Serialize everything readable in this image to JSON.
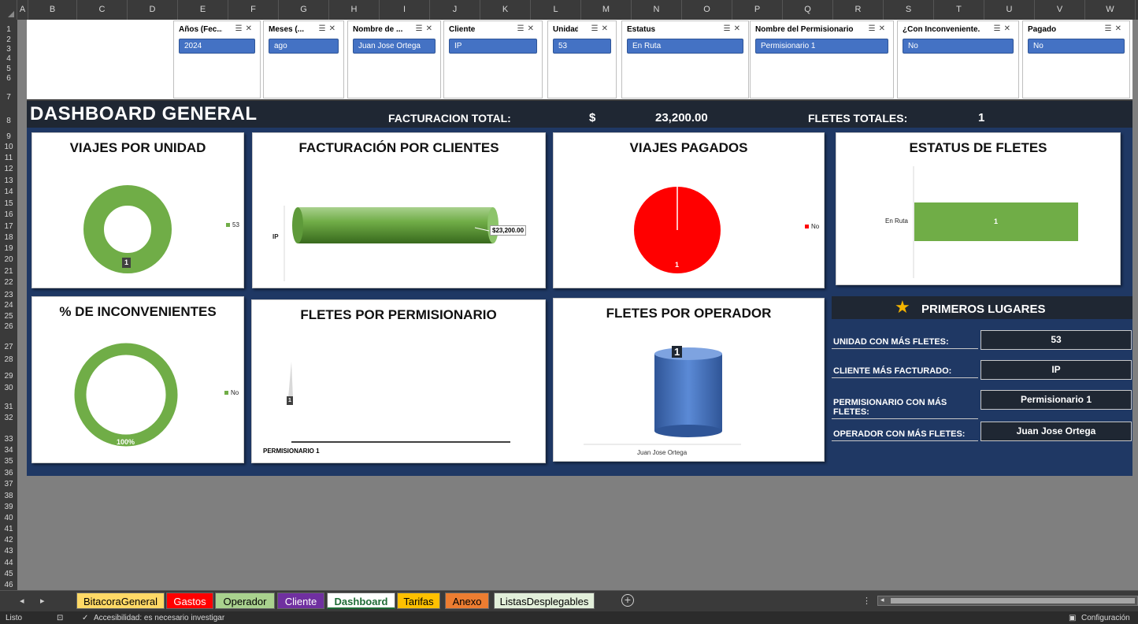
{
  "columns": [
    "A",
    "B",
    "C",
    "D",
    "E",
    "F",
    "G",
    "H",
    "I",
    "J",
    "K",
    "L",
    "M",
    "N",
    "O",
    "P",
    "Q",
    "R",
    "S",
    "T",
    "U",
    "V",
    "W"
  ],
  "rows": [
    "1",
    "2",
    "3",
    "4",
    "5",
    "6",
    "7",
    "8",
    "9",
    "10",
    "11",
    "12",
    "13",
    "14",
    "15",
    "16",
    "17",
    "18",
    "19",
    "20",
    "21",
    "22",
    "23",
    "24",
    "25",
    "26",
    "27",
    "28",
    "29",
    "30",
    "31",
    "32",
    "33",
    "34",
    "35",
    "36",
    "37",
    "38",
    "39",
    "40",
    "41",
    "42",
    "43",
    "44",
    "45",
    "46"
  ],
  "slicers": [
    {
      "title": "Años (Fec...",
      "value": "2024"
    },
    {
      "title": "Meses (...",
      "value": "ago"
    },
    {
      "title": "Nombre de ...",
      "value": "Juan Jose Ortega"
    },
    {
      "title": "Cliente",
      "value": "IP"
    },
    {
      "title": "Unidad",
      "value": "53"
    },
    {
      "title": "Estatus",
      "value": "En Ruta"
    },
    {
      "title": "Nombre del Permisionario",
      "value": "Permisionario 1"
    },
    {
      "title": "¿Con Inconveniente...",
      "value": "No"
    },
    {
      "title": "Pagado",
      "value": "No"
    }
  ],
  "header": {
    "title": "DASHBOARD GENERAL",
    "facturacion_label": "FACTURACION TOTAL:",
    "currency": "$",
    "facturacion_value": "23,200.00",
    "fletes_label": "FLETES TOTALES:",
    "fletes_value": "1"
  },
  "cards": {
    "viajes_unidad": {
      "title": "VIAJES POR UNIDAD",
      "legend": "53",
      "label": "1"
    },
    "facturacion_clientes": {
      "title": "FACTURACIÓN POR CLIENTES",
      "category": "IP",
      "label": "$23,200.00"
    },
    "viajes_pagados": {
      "title": "VIAJES PAGADOS",
      "legend": "No",
      "label": "1"
    },
    "estatus_fletes": {
      "title": "ESTATUS DE FLETES",
      "category": "En Ruta",
      "label": "1"
    },
    "inconvenientes": {
      "title": "% DE INCONVENIENTES",
      "legend": "No",
      "label": "100%"
    },
    "fletes_permisionario": {
      "title": "FLETES POR PERMISIONARIO",
      "category": "PERMISIONARIO 1",
      "label": "1"
    },
    "fletes_operador": {
      "title": "FLETES POR OPERADOR",
      "category": "Juan Jose Ortega",
      "label": "1"
    }
  },
  "chart_data": [
    {
      "type": "pie",
      "title": "VIAJES POR UNIDAD",
      "categories": [
        "53"
      ],
      "values": [
        1
      ]
    },
    {
      "type": "bar",
      "title": "FACTURACIÓN POR CLIENTES",
      "categories": [
        "IP"
      ],
      "values": [
        23200
      ]
    },
    {
      "type": "pie",
      "title": "VIAJES PAGADOS",
      "categories": [
        "No"
      ],
      "values": [
        1
      ]
    },
    {
      "type": "bar",
      "title": "ESTATUS DE FLETES",
      "categories": [
        "En Ruta"
      ],
      "values": [
        1
      ]
    },
    {
      "type": "pie",
      "title": "% DE INCONVENIENTES",
      "categories": [
        "No"
      ],
      "values": [
        1
      ]
    },
    {
      "type": "bar",
      "title": "FLETES POR PERMISIONARIO",
      "categories": [
        "PERMISIONARIO 1"
      ],
      "values": [
        1
      ]
    },
    {
      "type": "bar",
      "title": "FLETES POR OPERADOR",
      "categories": [
        "Juan Jose Ortega"
      ],
      "values": [
        1
      ]
    }
  ],
  "primeros_lugares": {
    "title": "PRIMEROS LUGARES",
    "items": [
      {
        "label": "UNIDAD CON MÁS FLETES:",
        "value": "53"
      },
      {
        "label": "CLIENTE MÁS FACTURADO:",
        "value": "IP"
      },
      {
        "label": "PERMISIONARIO CON MÁS FLETES:",
        "value": "Permisionario 1"
      },
      {
        "label": "OPERADOR CON MÁS FLETES:",
        "value": "Juan Jose Ortega"
      }
    ]
  },
  "tabs": [
    {
      "label": "BitacoraGeneral",
      "color": "#ffd966"
    },
    {
      "label": "Gastos",
      "color": "#ff0000"
    },
    {
      "label": "Operador",
      "color": "#a9d18e"
    },
    {
      "label": "Cliente",
      "color": "#7030a0"
    },
    {
      "label": "Dashboard",
      "color": "#ffffff"
    },
    {
      "label": "Tarifas",
      "color": "#ffc000"
    },
    {
      "label": "Anexo",
      "color": "#ed7d31"
    },
    {
      "label": "ListasDesplegables",
      "color": "#e2efda"
    }
  ],
  "status": {
    "ready": "Listo",
    "accessibility": "Accesibilidad: es necesario investigar",
    "settings": "Configuración"
  },
  "colors": {
    "green": "#70ad47",
    "red": "#ff0000",
    "blue": "#4472c4",
    "navy": "#1f3864"
  }
}
